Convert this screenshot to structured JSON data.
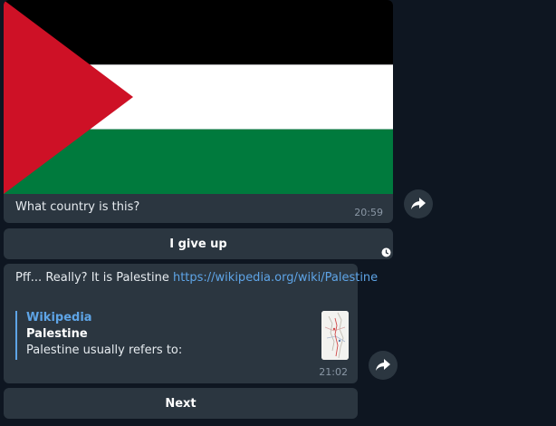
{
  "messages": [
    {
      "caption": "What country is this?",
      "time": "20:59",
      "image_icon": "palestine-flag-image",
      "flag_colors": {
        "top": "#000000",
        "middle": "#ffffff",
        "bottom": "#007a3d",
        "triangle": "#ce1126"
      }
    },
    {
      "text": "Pff... Really? It is Palestine ",
      "link": "https://wikipedia.org/wiki/Palestine",
      "preview": {
        "site": "Wikipedia",
        "title": "Palestine",
        "description": "Palestine usually refers to:",
        "thumb_icon": "map-thumbnail"
      },
      "time": "21:02"
    }
  ],
  "buttons": {
    "give_up": "I give up",
    "next": "Next"
  },
  "icons": {
    "share": "share-arrow-icon",
    "pending": "clock-icon"
  },
  "colors": {
    "background": "#0e1621",
    "bubble": "#2b3640",
    "link": "#5ea4e6",
    "meta": "#8a97a5"
  }
}
